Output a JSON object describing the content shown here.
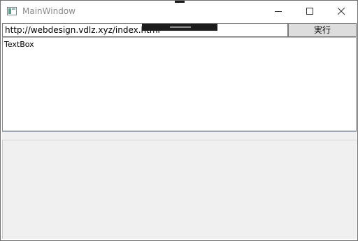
{
  "window": {
    "title": "MainWindow"
  },
  "toolbar": {
    "url_value": "http://webdesign.vdlz.xyz/index.html",
    "run_label": "実行"
  },
  "textbox": {
    "content": "TextBox"
  },
  "icons": {
    "app": "app-window-icon",
    "minimize": "minimize-icon",
    "maximize": "maximize-icon",
    "close": "close-icon"
  },
  "colors": {
    "title_text": "#8a8a8a",
    "button_bg": "#dddddd",
    "panel_bg": "#f0f0f0"
  }
}
